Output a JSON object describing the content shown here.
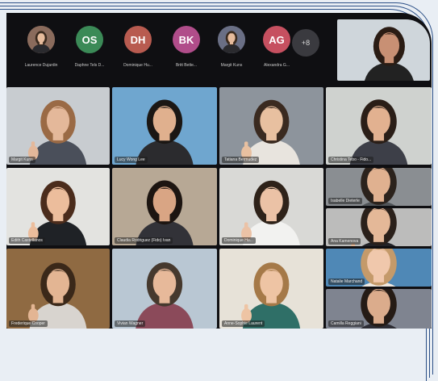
{
  "participant_strip": [
    {
      "initials": "",
      "name": "Laurence Dujardin",
      "avatar": "photo",
      "color": "#8a6b5c"
    },
    {
      "initials": "OS",
      "name": "Daphne Tels D...",
      "avatar": "initials",
      "color": "#3b8a57"
    },
    {
      "initials": "DH",
      "name": "Dominique Hu...",
      "avatar": "initials",
      "color": "#b85b50"
    },
    {
      "initials": "BK",
      "name": "Britt Bette...",
      "avatar": "initials",
      "color": "#b04d8a"
    },
    {
      "initials": "",
      "name": "Margit Kuns",
      "avatar": "photo",
      "color": "#6a6f85"
    },
    {
      "initials": "AG",
      "name": "Alexandra G...",
      "avatar": "initials",
      "color": "#c65060"
    }
  ],
  "more_count": "+8",
  "tiles": [
    {
      "name": "Margit Kuns",
      "bg": "#c8ccd0",
      "skin": "#e4b89a",
      "hair": "#9a6a45",
      "shirt": "#4a4f5a"
    },
    {
      "name": "Lucy Wong Lee",
      "bg": "#6fa6cf",
      "skin": "#e0b08e",
      "hair": "#1b1714",
      "shirt": "#2b2b2e"
    },
    {
      "name": "Tatiana Bermudez",
      "bg": "#8d949c",
      "skin": "#e8c0a0",
      "hair": "#3a2a20",
      "shirt": "#e8e4de"
    },
    {
      "name": "Christina Tebo - Fido...",
      "bg": "#cfd2cf",
      "skin": "#e2b190",
      "hair": "#2a1e17",
      "shirt": "#3d3f48"
    },
    {
      "name": "Edith Castellanos",
      "bg": "#e3e3e0",
      "skin": "#ecbd9c",
      "hair": "#4b2c1c",
      "shirt": "#1f2226"
    },
    {
      "name": "Claudia Rodriguez (Fido) Ivan",
      "bg": "#b7a895",
      "skin": "#d9a584",
      "hair": "#1d1511",
      "shirt": "#323238"
    },
    {
      "name": "Dominique Hu...",
      "bg": "#d9d9d6",
      "skin": "#ebc2a6",
      "hair": "#2e2219",
      "shirt": "#f2f2f0"
    },
    {
      "name": "Isabelle Dieterle",
      "bg": "#8a8e92",
      "skin": "#e0b190",
      "hair": "#2b221c",
      "shirt": "#505458"
    },
    {
      "name": "Frederique Cooper",
      "bg": "#8f6a42",
      "skin": "#e3b593",
      "hair": "#3a2819",
      "shirt": "#d8d4cf"
    },
    {
      "name": "Vivian Wagner",
      "bg": "#b9c7d3",
      "skin": "#e7b99a",
      "hair": "#46392e",
      "shirt": "#8b4a5a"
    },
    {
      "name": "Anne-Sophie Laurent",
      "bg": "#e7e2d8",
      "skin": "#eec4a4",
      "hair": "#a57948",
      "shirt": "#2f6f67"
    },
    {
      "name": "Natalie Marchand",
      "bg": "#4f88b6",
      "skin": "#f0c8ac",
      "hair": "#c49a6a",
      "shirt": "#efe9e1"
    },
    {
      "name": "Ana Kamenova",
      "bg": "#bcbcbb",
      "skin": "#e4b898",
      "hair": "#2a201a",
      "shirt": "#222226"
    },
    {
      "name": "Camilla Reggiani",
      "bg": "#7f8490",
      "skin": "#dbac8c",
      "hair": "#251b15",
      "shirt": "#2c2c33"
    }
  ],
  "self_view": {
    "bg": "#cfd6db",
    "skin": "#c89074",
    "hair": "#2a1c14",
    "shirt": "#222"
  }
}
